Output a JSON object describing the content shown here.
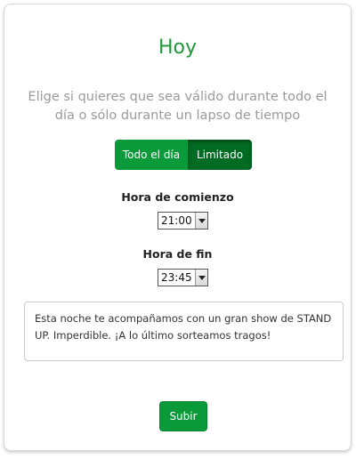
{
  "form": {
    "title": "Hoy",
    "subtitle": "Elige si quieres que sea válido durante todo el día o sólo durante un lapso de tiempo",
    "toggle": {
      "all_day_label": "Todo el día",
      "limited_label": "Limitado",
      "selected": "Limitado"
    },
    "start": {
      "label": "Hora de comienzo",
      "value": "21:00"
    },
    "end": {
      "label": "Hora de fin",
      "value": "23:45"
    },
    "message": "Esta noche te acompañamos con un gran show de STAND UP. Imperdible. ¡A lo último sorteamos tragos!",
    "submit_label": "Subir"
  },
  "colors": {
    "accent": "#0a9a3a",
    "accent_active": "#006b22",
    "title": "#1e9a3c",
    "subtitle": "#9a9a9a"
  },
  "icons": {
    "select_arrow": "triangle-down-icon"
  }
}
